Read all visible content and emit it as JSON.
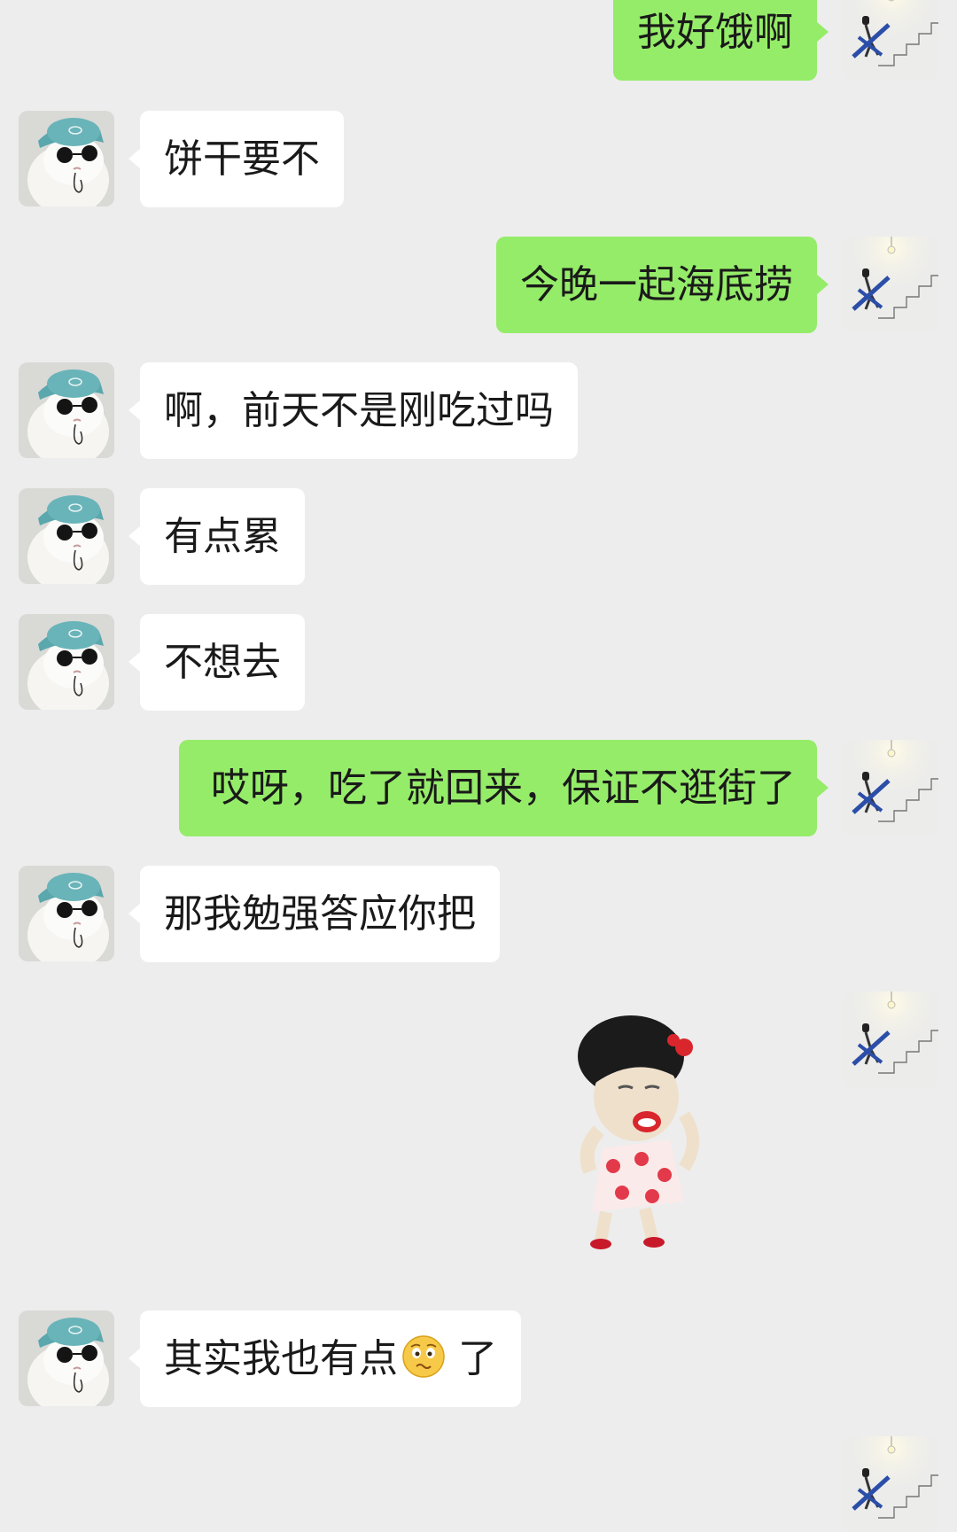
{
  "chat": {
    "messages": [
      {
        "side": "out",
        "text": "我好饿啊"
      },
      {
        "side": "in",
        "text": "饼干要不"
      },
      {
        "side": "out",
        "text": "今晚一起海底捞"
      },
      {
        "side": "in",
        "text": "啊，前天不是刚吃过吗"
      },
      {
        "side": "in",
        "text": "有点累"
      },
      {
        "side": "in",
        "text": "不想去"
      },
      {
        "side": "out",
        "text": "哎呀，吃了就回来，保证不逛街了"
      },
      {
        "side": "in",
        "text": "那我勉强答应你把"
      },
      {
        "side": "out",
        "type": "sticker",
        "sticker": "dancing-girl-meme-sticker"
      },
      {
        "side": "in",
        "text_before": "其实我也有点",
        "emoji": "confused-face-emoji",
        "text_after": "了"
      }
    ]
  },
  "avatars": {
    "self": "staircase-lightbulb-avatar",
    "contact": "cat-with-cap-sunglasses-avatar"
  },
  "colors": {
    "background": "#ededed",
    "incoming_bubble": "#ffffff",
    "outgoing_bubble": "#95ec69",
    "text": "#1a1a1a"
  }
}
